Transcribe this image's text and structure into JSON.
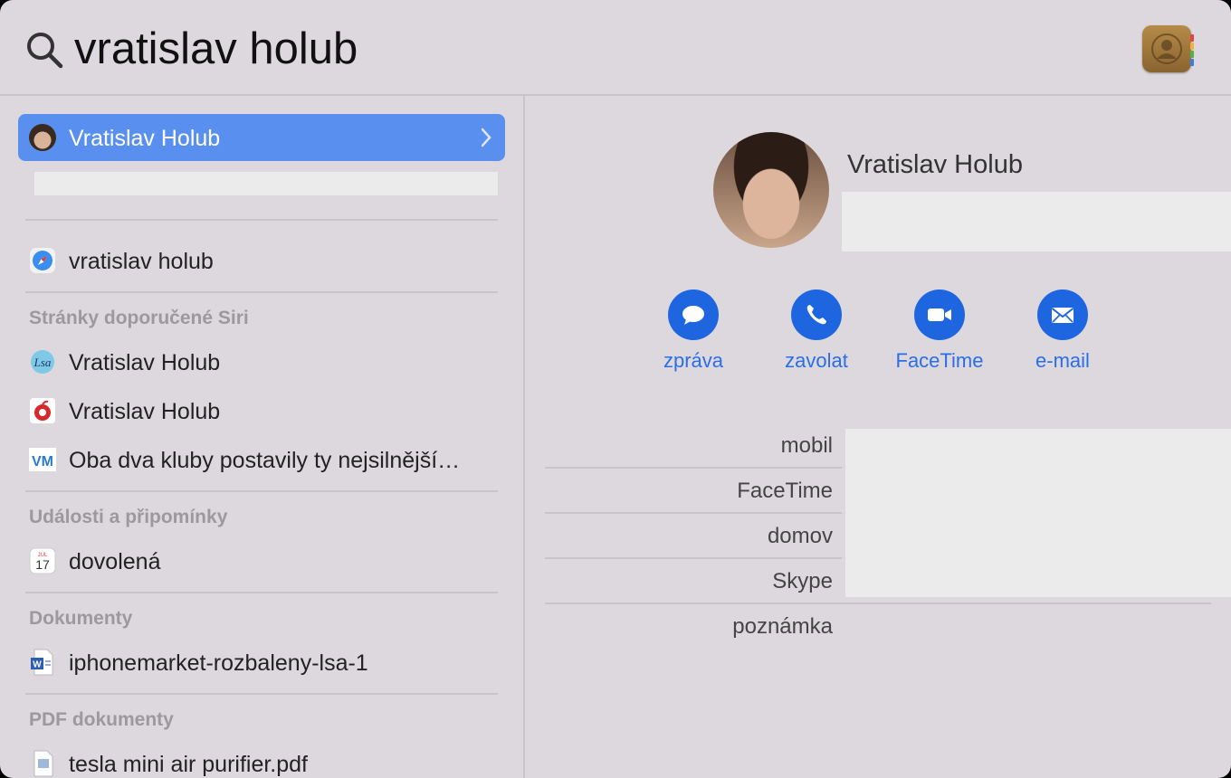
{
  "search": {
    "query": "vratislav holub"
  },
  "results": {
    "top_hit": {
      "label": "Vratislav Holub"
    },
    "web_search": {
      "label": "vratislav holub"
    },
    "siri_section": {
      "title": "Stránky doporučené Siri",
      "items": [
        {
          "label": "Vratislav Holub",
          "icon": "lsa-site-icon"
        },
        {
          "label": "Vratislav Holub",
          "icon": "red-apple-site-icon"
        },
        {
          "label": "Oba dva kluby postavily ty nejsilnější…",
          "icon": "vm-site-icon"
        }
      ]
    },
    "events_section": {
      "title": "Události a připomínky",
      "items": [
        {
          "label": "dovolená",
          "icon": "calendar-icon"
        }
      ]
    },
    "docs_section": {
      "title": "Dokumenty",
      "items": [
        {
          "label": "iphonemarket-rozbaleny-lsa-1",
          "icon": "word-doc-icon"
        }
      ]
    },
    "pdf_section": {
      "title": "PDF dokumenty",
      "items": [
        {
          "label": "tesla mini air purifier.pdf",
          "icon": "pdf-icon"
        }
      ]
    }
  },
  "calendar_icon": {
    "month": "JUL",
    "day": "17"
  },
  "vm_icon_text": "VM",
  "detail": {
    "name": "Vratislav Holub",
    "actions": [
      {
        "label": "zpráva",
        "icon": "message-icon"
      },
      {
        "label": "zavolat",
        "icon": "phone-icon"
      },
      {
        "label": "FaceTime",
        "icon": "video-icon"
      },
      {
        "label": "e-mail",
        "icon": "mail-icon"
      }
    ],
    "fields": [
      "mobil",
      "FaceTime",
      "domov",
      "Skype",
      "poznámka"
    ]
  },
  "colors": {
    "accent": "#5990ef",
    "action_blue": "#1e66e0",
    "background": "#ddd8de"
  }
}
